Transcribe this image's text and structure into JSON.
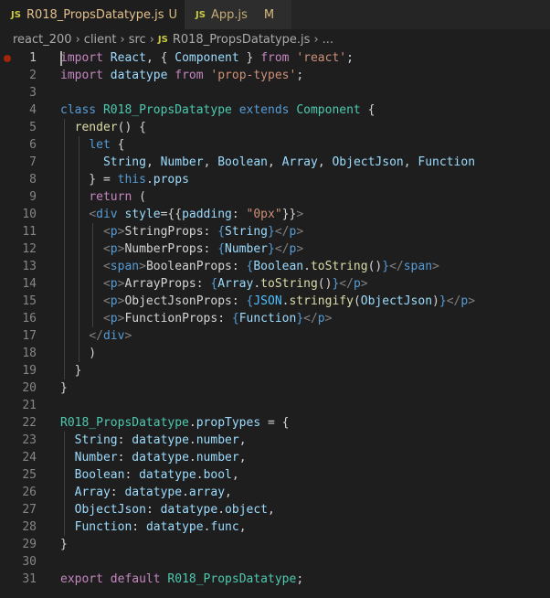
{
  "tabs": [
    {
      "icon": "JS",
      "name": "R018_PropsDatatype.js",
      "status": "U",
      "active": true
    },
    {
      "icon": "JS",
      "name": "App.js",
      "status": "M",
      "active": false
    }
  ],
  "breadcrumb": [
    "react_200",
    "client",
    "src",
    "R018_PropsDatatype.js",
    "..."
  ],
  "breadcrumb_icon": "JS",
  "cursor_line": 1,
  "breakpoint_line": 1,
  "lines": [
    {
      "n": "1",
      "t": [
        [
          "ctl",
          "import"
        ],
        [
          "pn",
          " "
        ],
        [
          "var",
          "React"
        ],
        [
          "pn",
          ", { "
        ],
        [
          "var",
          "Component"
        ],
        [
          "pn",
          " } "
        ],
        [
          "ctl",
          "from"
        ],
        [
          "pn",
          " "
        ],
        [
          "str",
          "'react'"
        ],
        [
          "pn",
          ";"
        ]
      ]
    },
    {
      "n": "2",
      "t": [
        [
          "ctl",
          "import"
        ],
        [
          "pn",
          " "
        ],
        [
          "var",
          "datatype"
        ],
        [
          "pn",
          " "
        ],
        [
          "ctl",
          "from"
        ],
        [
          "pn",
          " "
        ],
        [
          "str",
          "'prop-types'"
        ],
        [
          "pn",
          ";"
        ]
      ]
    },
    {
      "n": "3",
      "t": []
    },
    {
      "n": "4",
      "t": [
        [
          "kw",
          "class"
        ],
        [
          "pn",
          " "
        ],
        [
          "cls",
          "R018_PropsDatatype"
        ],
        [
          "pn",
          " "
        ],
        [
          "kw",
          "extends"
        ],
        [
          "pn",
          " "
        ],
        [
          "cls",
          "Component"
        ],
        [
          "pn",
          " {"
        ]
      ]
    },
    {
      "n": "5",
      "t": [
        [
          "pn",
          "  "
        ],
        [
          "fn",
          "render"
        ],
        [
          "pn",
          "() {"
        ]
      ]
    },
    {
      "n": "6",
      "t": [
        [
          "pn",
          "    "
        ],
        [
          "kw",
          "let"
        ],
        [
          "pn",
          " {"
        ]
      ]
    },
    {
      "n": "7",
      "t": [
        [
          "pn",
          "      "
        ],
        [
          "var",
          "String"
        ],
        [
          "pn",
          ", "
        ],
        [
          "var",
          "Number"
        ],
        [
          "pn",
          ", "
        ],
        [
          "var",
          "Boolean"
        ],
        [
          "pn",
          ", "
        ],
        [
          "var",
          "Array"
        ],
        [
          "pn",
          ", "
        ],
        [
          "var",
          "ObjectJson"
        ],
        [
          "pn",
          ", "
        ],
        [
          "var",
          "Function"
        ]
      ]
    },
    {
      "n": "8",
      "t": [
        [
          "pn",
          "    } = "
        ],
        [
          "kw",
          "this"
        ],
        [
          "pn",
          "."
        ],
        [
          "var",
          "props"
        ]
      ]
    },
    {
      "n": "9",
      "t": [
        [
          "pn",
          "    "
        ],
        [
          "ctl",
          "return"
        ],
        [
          "pn",
          " ("
        ]
      ]
    },
    {
      "n": "10",
      "t": [
        [
          "pn",
          "    "
        ],
        [
          "tg",
          "<"
        ],
        [
          "tn",
          "div"
        ],
        [
          "pn",
          " "
        ],
        [
          "at",
          "style"
        ],
        [
          "pn",
          "={{"
        ],
        [
          "var",
          "padding"
        ],
        [
          "pn",
          ": "
        ],
        [
          "str",
          "\"0px\""
        ],
        [
          "pn",
          "}}"
        ],
        [
          "tg",
          ">"
        ]
      ]
    },
    {
      "n": "11",
      "t": [
        [
          "pn",
          "      "
        ],
        [
          "tg",
          "<"
        ],
        [
          "tn",
          "p"
        ],
        [
          "tg",
          ">"
        ],
        [
          "txt",
          "StringProps: "
        ],
        [
          "kw",
          "{"
        ],
        [
          "var",
          "String"
        ],
        [
          "kw",
          "}"
        ],
        [
          "tg",
          "</"
        ],
        [
          "tn",
          "p"
        ],
        [
          "tg",
          ">"
        ]
      ]
    },
    {
      "n": "12",
      "t": [
        [
          "pn",
          "      "
        ],
        [
          "tg",
          "<"
        ],
        [
          "tn",
          "p"
        ],
        [
          "tg",
          ">"
        ],
        [
          "txt",
          "NumberProps: "
        ],
        [
          "kw",
          "{"
        ],
        [
          "var",
          "Number"
        ],
        [
          "kw",
          "}"
        ],
        [
          "tg",
          "</"
        ],
        [
          "tn",
          "p"
        ],
        [
          "tg",
          ">"
        ]
      ]
    },
    {
      "n": "13",
      "t": [
        [
          "pn",
          "      "
        ],
        [
          "tg",
          "<"
        ],
        [
          "tn",
          "span"
        ],
        [
          "tg",
          ">"
        ],
        [
          "txt",
          "BooleanProps: "
        ],
        [
          "kw",
          "{"
        ],
        [
          "var",
          "Boolean"
        ],
        [
          "pn",
          "."
        ],
        [
          "fn",
          "toString"
        ],
        [
          "pn",
          "()"
        ],
        [
          "kw",
          "}"
        ],
        [
          "tg",
          "</"
        ],
        [
          "tn",
          "span"
        ],
        [
          "tg",
          ">"
        ]
      ]
    },
    {
      "n": "14",
      "t": [
        [
          "pn",
          "      "
        ],
        [
          "tg",
          "<"
        ],
        [
          "tn",
          "p"
        ],
        [
          "tg",
          ">"
        ],
        [
          "txt",
          "ArrayProps: "
        ],
        [
          "kw",
          "{"
        ],
        [
          "var",
          "Array"
        ],
        [
          "pn",
          "."
        ],
        [
          "fn",
          "toString"
        ],
        [
          "pn",
          "()"
        ],
        [
          "kw",
          "}"
        ],
        [
          "tg",
          "</"
        ],
        [
          "tn",
          "p"
        ],
        [
          "tg",
          ">"
        ]
      ]
    },
    {
      "n": "15",
      "t": [
        [
          "pn",
          "      "
        ],
        [
          "tg",
          "<"
        ],
        [
          "tn",
          "p"
        ],
        [
          "tg",
          ">"
        ],
        [
          "txt",
          "ObjectJsonProps: "
        ],
        [
          "kw",
          "{"
        ],
        [
          "cst",
          "JSON"
        ],
        [
          "pn",
          "."
        ],
        [
          "fn",
          "stringify"
        ],
        [
          "pn",
          "("
        ],
        [
          "var",
          "ObjectJson"
        ],
        [
          "pn",
          ")"
        ],
        [
          "kw",
          "}"
        ],
        [
          "tg",
          "</"
        ],
        [
          "tn",
          "p"
        ],
        [
          "tg",
          ">"
        ]
      ]
    },
    {
      "n": "16",
      "t": [
        [
          "pn",
          "      "
        ],
        [
          "tg",
          "<"
        ],
        [
          "tn",
          "p"
        ],
        [
          "tg",
          ">"
        ],
        [
          "txt",
          "FunctionProps: "
        ],
        [
          "kw",
          "{"
        ],
        [
          "var",
          "Function"
        ],
        [
          "kw",
          "}"
        ],
        [
          "tg",
          "</"
        ],
        [
          "tn",
          "p"
        ],
        [
          "tg",
          ">"
        ]
      ]
    },
    {
      "n": "17",
      "t": [
        [
          "pn",
          "    "
        ],
        [
          "tg",
          "</"
        ],
        [
          "tn",
          "div"
        ],
        [
          "tg",
          ">"
        ]
      ]
    },
    {
      "n": "18",
      "t": [
        [
          "pn",
          "    )"
        ]
      ]
    },
    {
      "n": "19",
      "t": [
        [
          "pn",
          "  }"
        ]
      ]
    },
    {
      "n": "20",
      "t": [
        [
          "pn",
          "}"
        ]
      ]
    },
    {
      "n": "21",
      "t": []
    },
    {
      "n": "22",
      "t": [
        [
          "cls",
          "R018_PropsDatatype"
        ],
        [
          "pn",
          "."
        ],
        [
          "var",
          "propTypes"
        ],
        [
          "pn",
          " = {"
        ]
      ]
    },
    {
      "n": "23",
      "t": [
        [
          "pn",
          "  "
        ],
        [
          "var",
          "String"
        ],
        [
          "pn",
          ": "
        ],
        [
          "var",
          "datatype"
        ],
        [
          "pn",
          "."
        ],
        [
          "var",
          "number"
        ],
        [
          "pn",
          ","
        ]
      ]
    },
    {
      "n": "24",
      "t": [
        [
          "pn",
          "  "
        ],
        [
          "var",
          "Number"
        ],
        [
          "pn",
          ": "
        ],
        [
          "var",
          "datatype"
        ],
        [
          "pn",
          "."
        ],
        [
          "var",
          "number"
        ],
        [
          "pn",
          ","
        ]
      ]
    },
    {
      "n": "25",
      "t": [
        [
          "pn",
          "  "
        ],
        [
          "var",
          "Boolean"
        ],
        [
          "pn",
          ": "
        ],
        [
          "var",
          "datatype"
        ],
        [
          "pn",
          "."
        ],
        [
          "var",
          "bool"
        ],
        [
          "pn",
          ","
        ]
      ]
    },
    {
      "n": "26",
      "t": [
        [
          "pn",
          "  "
        ],
        [
          "var",
          "Array"
        ],
        [
          "pn",
          ": "
        ],
        [
          "var",
          "datatype"
        ],
        [
          "pn",
          "."
        ],
        [
          "var",
          "array"
        ],
        [
          "pn",
          ","
        ]
      ]
    },
    {
      "n": "27",
      "t": [
        [
          "pn",
          "  "
        ],
        [
          "var",
          "ObjectJson"
        ],
        [
          "pn",
          ": "
        ],
        [
          "var",
          "datatype"
        ],
        [
          "pn",
          "."
        ],
        [
          "var",
          "object"
        ],
        [
          "pn",
          ","
        ]
      ]
    },
    {
      "n": "28",
      "t": [
        [
          "pn",
          "  "
        ],
        [
          "var",
          "Function"
        ],
        [
          "pn",
          ": "
        ],
        [
          "var",
          "datatype"
        ],
        [
          "pn",
          "."
        ],
        [
          "var",
          "func"
        ],
        [
          "pn",
          ","
        ]
      ]
    },
    {
      "n": "29",
      "t": [
        [
          "pn",
          "}"
        ]
      ]
    },
    {
      "n": "30",
      "t": []
    },
    {
      "n": "31",
      "t": [
        [
          "ctl",
          "export"
        ],
        [
          "pn",
          " "
        ],
        [
          "ctl",
          "default"
        ],
        [
          "pn",
          " "
        ],
        [
          "cls",
          "R018_PropsDatatype"
        ],
        [
          "pn",
          ";"
        ]
      ]
    }
  ]
}
